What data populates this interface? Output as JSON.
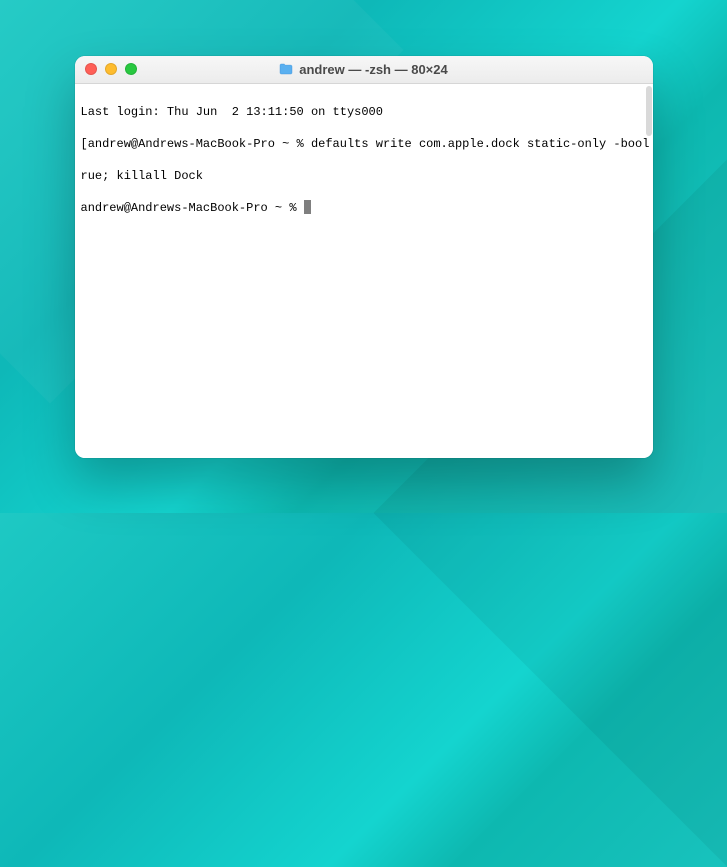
{
  "window": {
    "title": "andrew — -zsh — 80×24"
  },
  "terminal": {
    "line1": "Last login: Thu Jun  2 13:11:50 on ttys000",
    "line2_left": "[",
    "line2_mid": "andrew@Andrews-MacBook-Pro ~ % defaults write com.apple.dock static-only -bool t",
    "line2_right": "]",
    "line3": "rue; killall Dock",
    "line4_prompt": "andrew@Andrews-MacBook-Pro ~ % "
  }
}
